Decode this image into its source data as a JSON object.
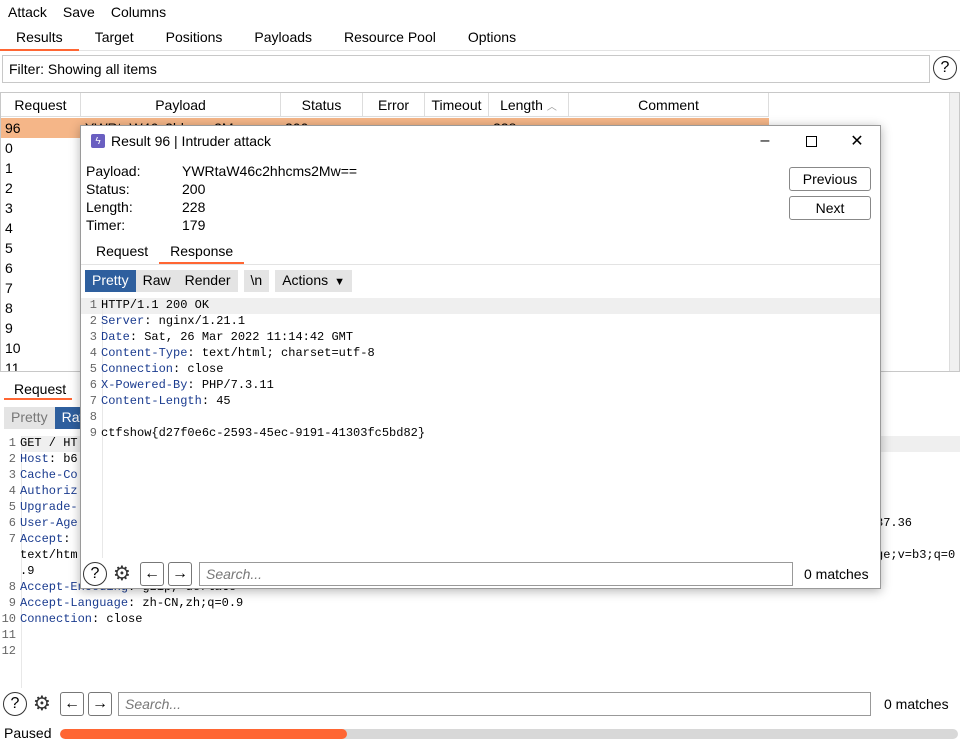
{
  "menu": [
    "Attack",
    "Save",
    "Columns"
  ],
  "tabs": [
    "Results",
    "Target",
    "Positions",
    "Payloads",
    "Resource Pool",
    "Options"
  ],
  "filter": {
    "text": "Filter: Showing all items"
  },
  "table": {
    "columns": [
      "Request",
      "Payload",
      "Status",
      "Error",
      "Timeout",
      "Length",
      "Comment"
    ],
    "rows": [
      "96",
      "0",
      "1",
      "2",
      "3",
      "4",
      "5",
      "6",
      "7",
      "8",
      "9",
      "10",
      "11"
    ],
    "selected_payload": "YWRtaW46c2hhcms2Mw==",
    "selected_status": "200",
    "selected_length": "228"
  },
  "bottom": {
    "tab": "Request",
    "modes": [
      "Pretty",
      "Raw"
    ],
    "lines": [
      {
        "n": "1",
        "key": "GET / HT",
        "val": ""
      },
      {
        "n": "2",
        "key": "Host",
        "val": ": b6"
      },
      {
        "n": "3",
        "key": "Cache-Co",
        "val": ""
      },
      {
        "n": "4",
        "key": "Authoriz",
        "val": ""
      },
      {
        "n": "5",
        "key": "Upgrade-",
        "val": ""
      },
      {
        "n": "6",
        "key": "User-Age",
        "val": ""
      },
      {
        "n": "7",
        "key": "Accept",
        "val": ":"
      },
      {
        "n": "",
        "key": "",
        "val": "text/htm"
      },
      {
        "n": "",
        "key": "",
        "val": ".9"
      },
      {
        "n": "8",
        "key": "Accept-Encoding",
        "val": ": gzip, deflate"
      },
      {
        "n": "9",
        "key": "Accept-Language",
        "val": ": zh-CN,zh;q=0.9"
      },
      {
        "n": "10",
        "key": "Connection",
        "val": ": close"
      },
      {
        "n": "11",
        "key": "",
        "val": ""
      },
      {
        "n": "12",
        "key": "",
        "val": ""
      }
    ],
    "right_fragments": [
      "37.36",
      "ge;v=b3;q=0"
    ],
    "search_placeholder": "Search...",
    "matches": "0 matches"
  },
  "status": {
    "text": "Paused",
    "progress_fraction": 0.32
  },
  "dialog": {
    "title": "Result 96 | Intruder attack",
    "fields": [
      {
        "k": "Payload:",
        "v": "YWRtaW46c2hhcms2Mw=="
      },
      {
        "k": "Status:",
        "v": "200"
      },
      {
        "k": "Length:",
        "v": "228"
      },
      {
        "k": "Timer:",
        "v": "179"
      }
    ],
    "previous": "Previous",
    "next": "Next",
    "tabs": [
      "Request",
      "Response"
    ],
    "tools": [
      "Pretty",
      "Raw",
      "Render",
      "\\n",
      "Actions"
    ],
    "response": [
      {
        "n": "1",
        "key": "HTTP/1.1 200 OK",
        "val": ""
      },
      {
        "n": "2",
        "key": "Server",
        "val": ": nginx/1.21.1"
      },
      {
        "n": "3",
        "key": "Date",
        "val": ": Sat, 26 Mar 2022 11:14:42 GMT"
      },
      {
        "n": "4",
        "key": "Content-Type",
        "val": ": text/html; charset=utf-8"
      },
      {
        "n": "5",
        "key": "Connection",
        "val": ": close"
      },
      {
        "n": "6",
        "key": "X-Powered-By",
        "val": ": PHP/7.3.11"
      },
      {
        "n": "7",
        "key": "Content-Length",
        "val": ": 45"
      },
      {
        "n": "8",
        "key": "",
        "val": ""
      },
      {
        "n": "9",
        "key": "",
        "val": "ctfshow{d27f0e6c-2593-45ec-9191-41303fc5bd82}"
      }
    ],
    "search_placeholder": "Search...",
    "matches": "0 matches"
  }
}
